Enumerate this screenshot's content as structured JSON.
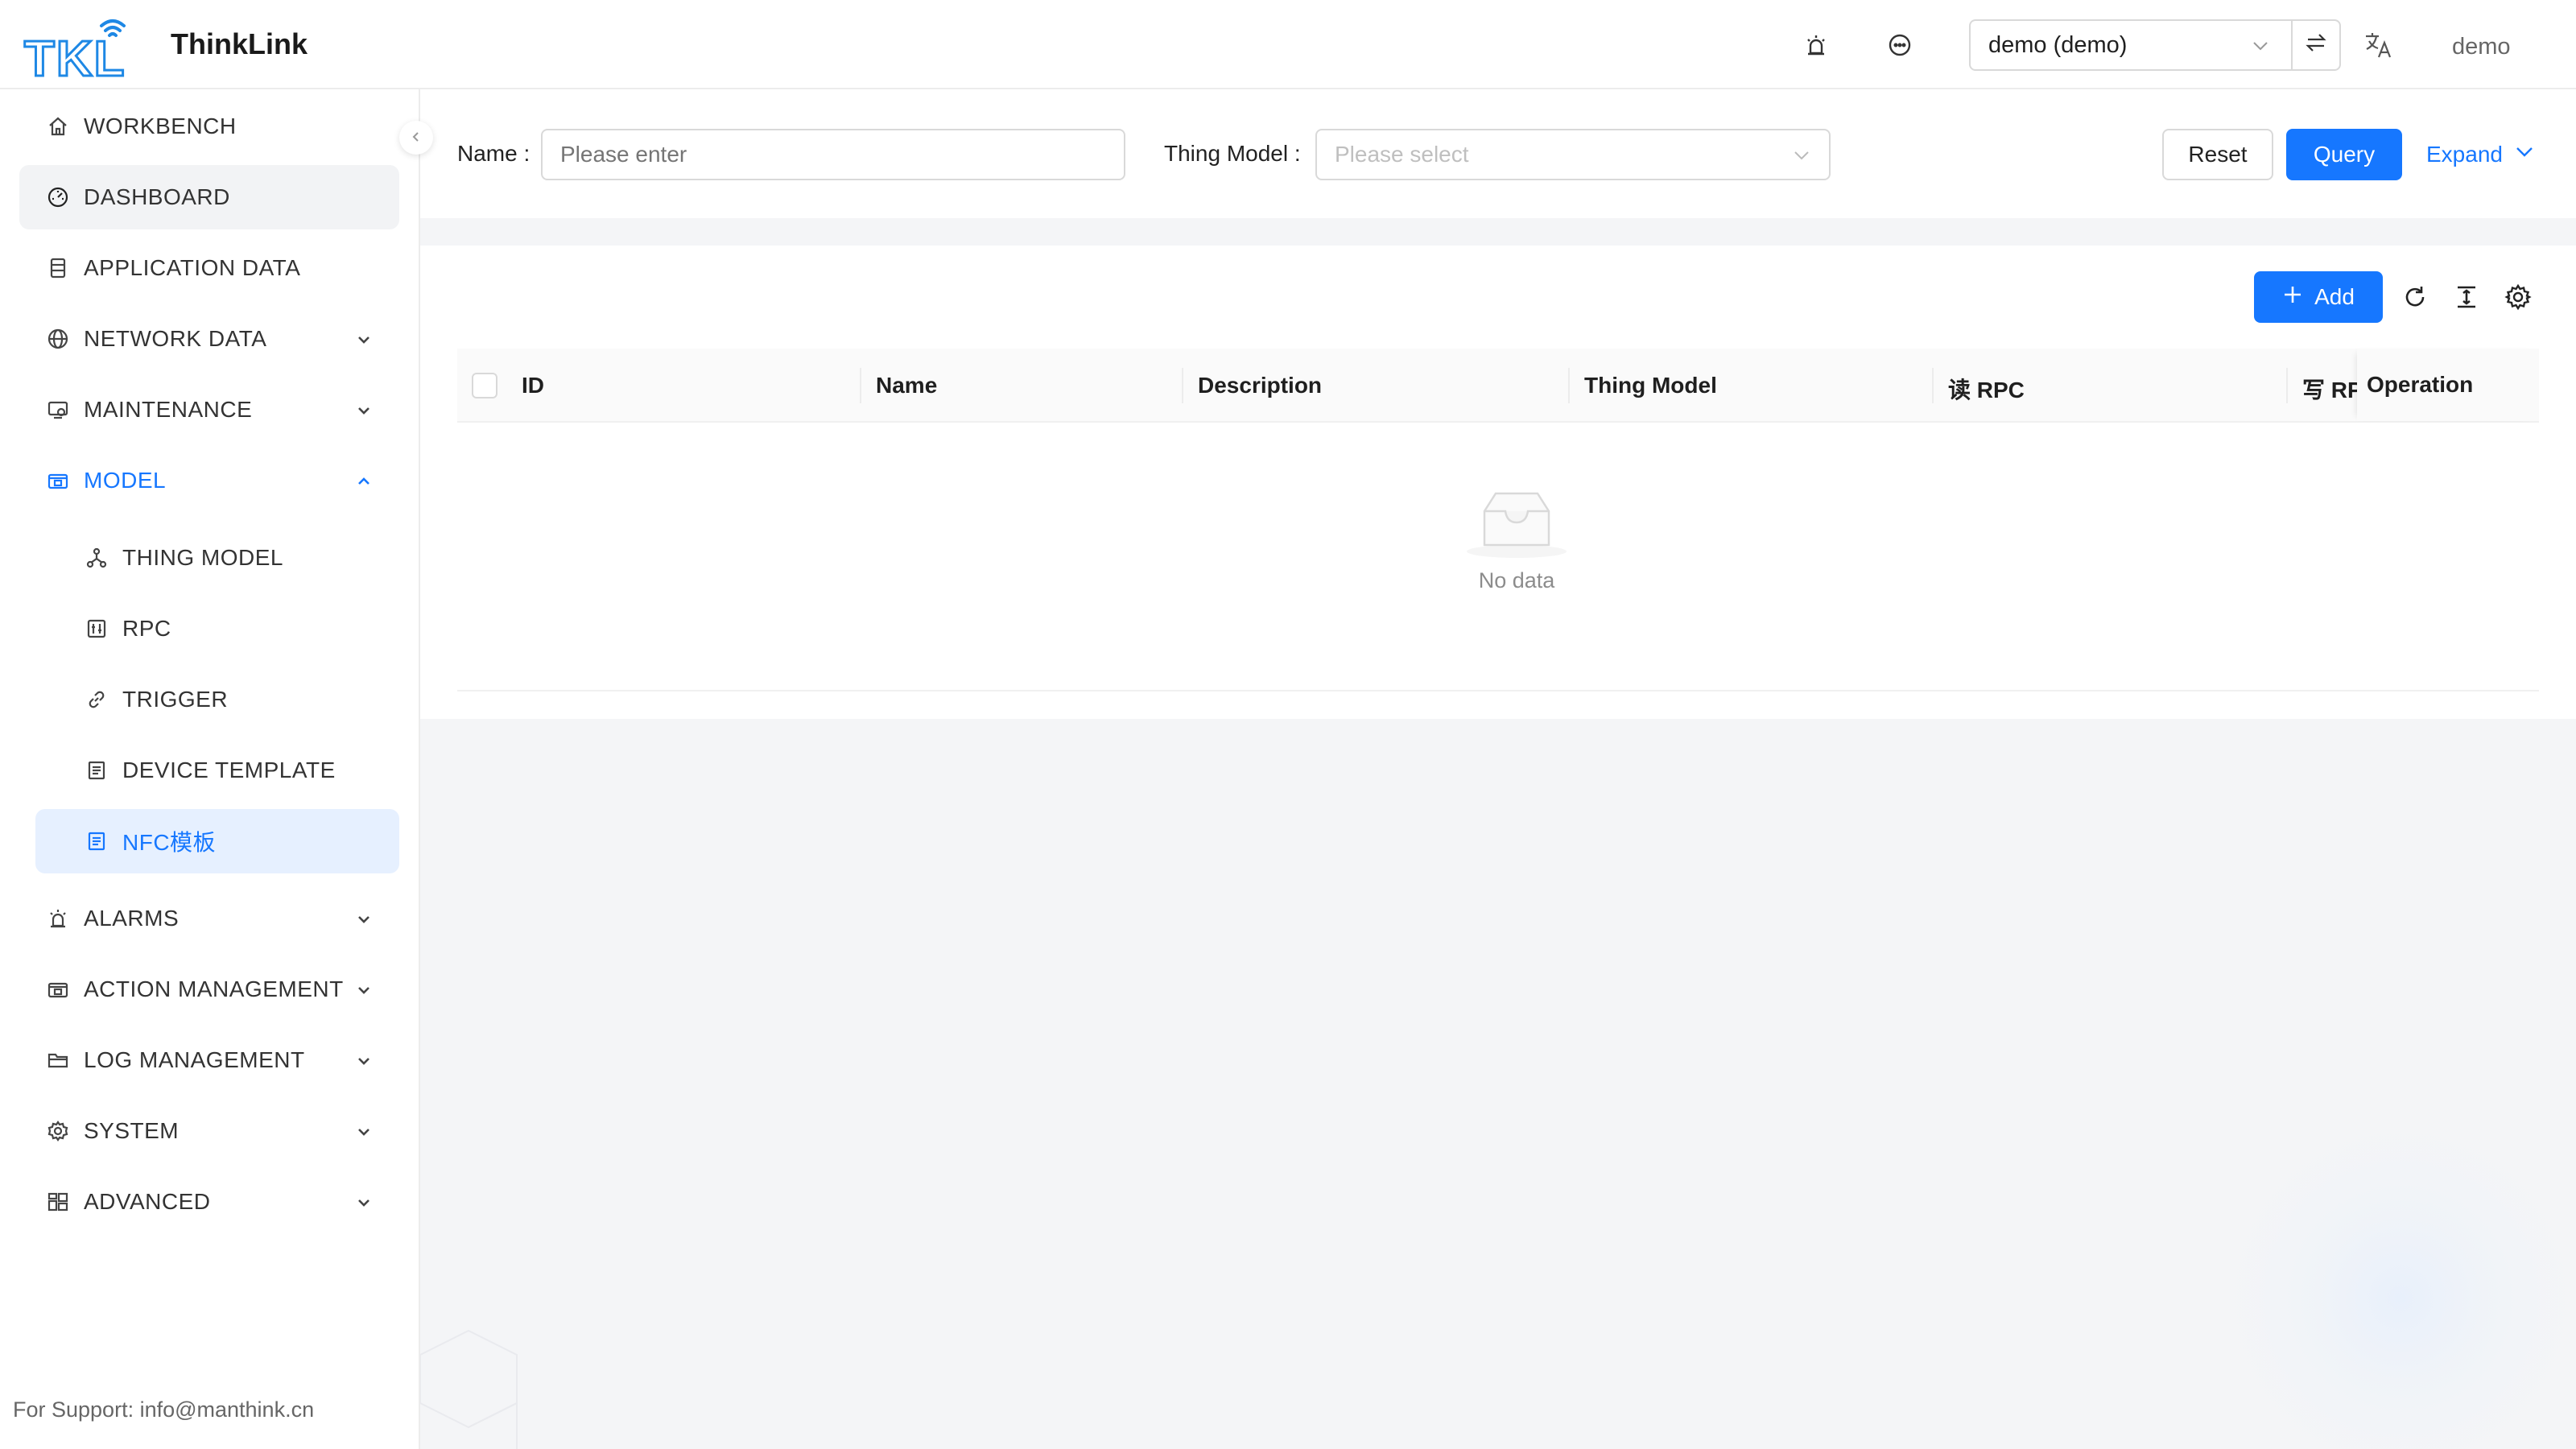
{
  "header": {
    "app_title": "ThinkLink",
    "logo_text": "TKL",
    "tenant_value": "demo (demo)",
    "user_name": "demo",
    "icons": [
      "alarm-icon",
      "message-icon",
      "swap-icon",
      "translate-icon"
    ]
  },
  "sidebar": {
    "items": [
      {
        "label": "WORKBENCH",
        "icon": "home-icon"
      },
      {
        "label": "DASHBOARD",
        "icon": "dashboard-icon"
      },
      {
        "label": "APPLICATION DATA",
        "icon": "database-icon"
      },
      {
        "label": "NETWORK DATA",
        "icon": "globe-icon"
      },
      {
        "label": "MAINTENANCE",
        "icon": "maintenance-icon"
      },
      {
        "label": "MODEL",
        "icon": "model-icon"
      },
      {
        "label": "ALARMS",
        "icon": "alarm-icon"
      },
      {
        "label": "ACTION MANAGEMENT",
        "icon": "action-icon"
      },
      {
        "label": "LOG MANAGEMENT",
        "icon": "folder-icon"
      },
      {
        "label": "SYSTEM",
        "icon": "gear-icon"
      },
      {
        "label": "ADVANCED",
        "icon": "advanced-icon"
      }
    ],
    "model_children": [
      {
        "label": "THING MODEL",
        "icon": "network-node-icon"
      },
      {
        "label": "RPC",
        "icon": "rpc-icon"
      },
      {
        "label": "TRIGGER",
        "icon": "link-icon"
      },
      {
        "label": "DEVICE TEMPLATE",
        "icon": "template-icon"
      },
      {
        "label": "NFC模板",
        "icon": "template-icon"
      }
    ],
    "support_text": "For Support: info@manthink.cn"
  },
  "search": {
    "name_label": "Name",
    "name_placeholder": "Please enter",
    "thing_model_label": "Thing Model",
    "thing_model_placeholder": "Please select",
    "reset_label": "Reset",
    "query_label": "Query",
    "expand_label": "Expand"
  },
  "table": {
    "add_label": "Add",
    "columns": [
      "ID",
      "Name",
      "Description",
      "Thing Model",
      "读 RPC",
      "写 RPC",
      "Operation"
    ],
    "empty_text": "No data"
  },
  "colors": {
    "primary": "#1677ff",
    "selected_bg": "#e6f0ff",
    "active_bg": "#f2f3f5"
  }
}
